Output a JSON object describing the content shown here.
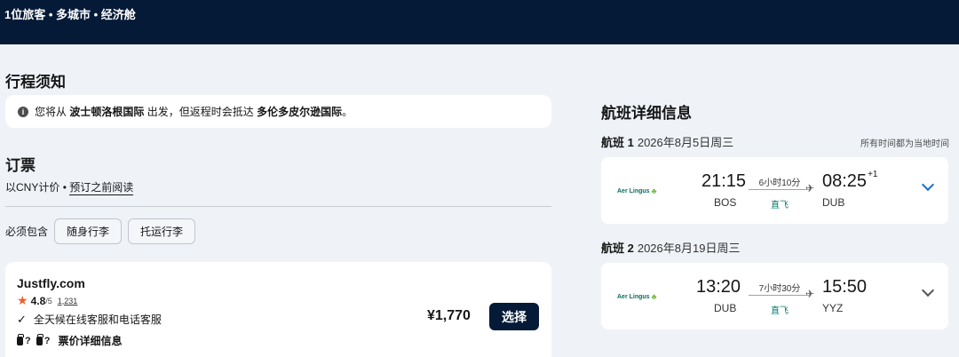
{
  "header": {
    "trip_summary": "1位旅客 • 多城市 • 经济舱"
  },
  "notice": {
    "title": "行程须知",
    "text_prefix": "您将从",
    "origin": "波士顿洛根国际",
    "text_middle": "出发，但返程时会抵达",
    "destination": "多伦多皮尔逊国际",
    "text_suffix": "。"
  },
  "booking": {
    "title": "订票",
    "currency_text": "以CNY计价",
    "separator": "•",
    "read_before_link": "预订之前阅读",
    "must_include_label": "必须包含",
    "chips": [
      "随身行李",
      "托运行李"
    ]
  },
  "offer": {
    "provider": "Justfly.com",
    "rating_score": "4.8",
    "rating_of": "/5",
    "rating_count": "1,231",
    "service_text": "全天候在线客服和电话客服",
    "bag_unknown_1": "?",
    "bag_unknown_2": "?",
    "fare_details": "票价详细信息",
    "price": "¥1,770",
    "select_label": "选择"
  },
  "flight_details": {
    "title": "航班详细信息",
    "local_time_note": "所有时间都为当地时间",
    "segments": [
      {
        "label": "航班 1",
        "date": "2026年8月5日周三",
        "airline": "Aer Lingus",
        "depart_time": "21:15",
        "depart_code": "BOS",
        "duration": "6小时10分",
        "stops": "直飞",
        "arrive_time": "08:25",
        "arrive_offset": "+1",
        "arrive_code": "DUB"
      },
      {
        "label": "航班 2",
        "date": "2026年8月19日周三",
        "airline": "Aer Lingus",
        "depart_time": "13:20",
        "depart_code": "DUB",
        "duration": "7小时30分",
        "stops": "直飞",
        "arrive_time": "15:50",
        "arrive_offset": "",
        "arrive_code": "YYZ"
      }
    ]
  },
  "colors": {
    "header_bg": "#051a37",
    "page_bg": "#eff3f8",
    "accent_blue": "#1a6fd0",
    "nonstop_green": "#0a7a6b",
    "star_orange": "#e8612d"
  }
}
